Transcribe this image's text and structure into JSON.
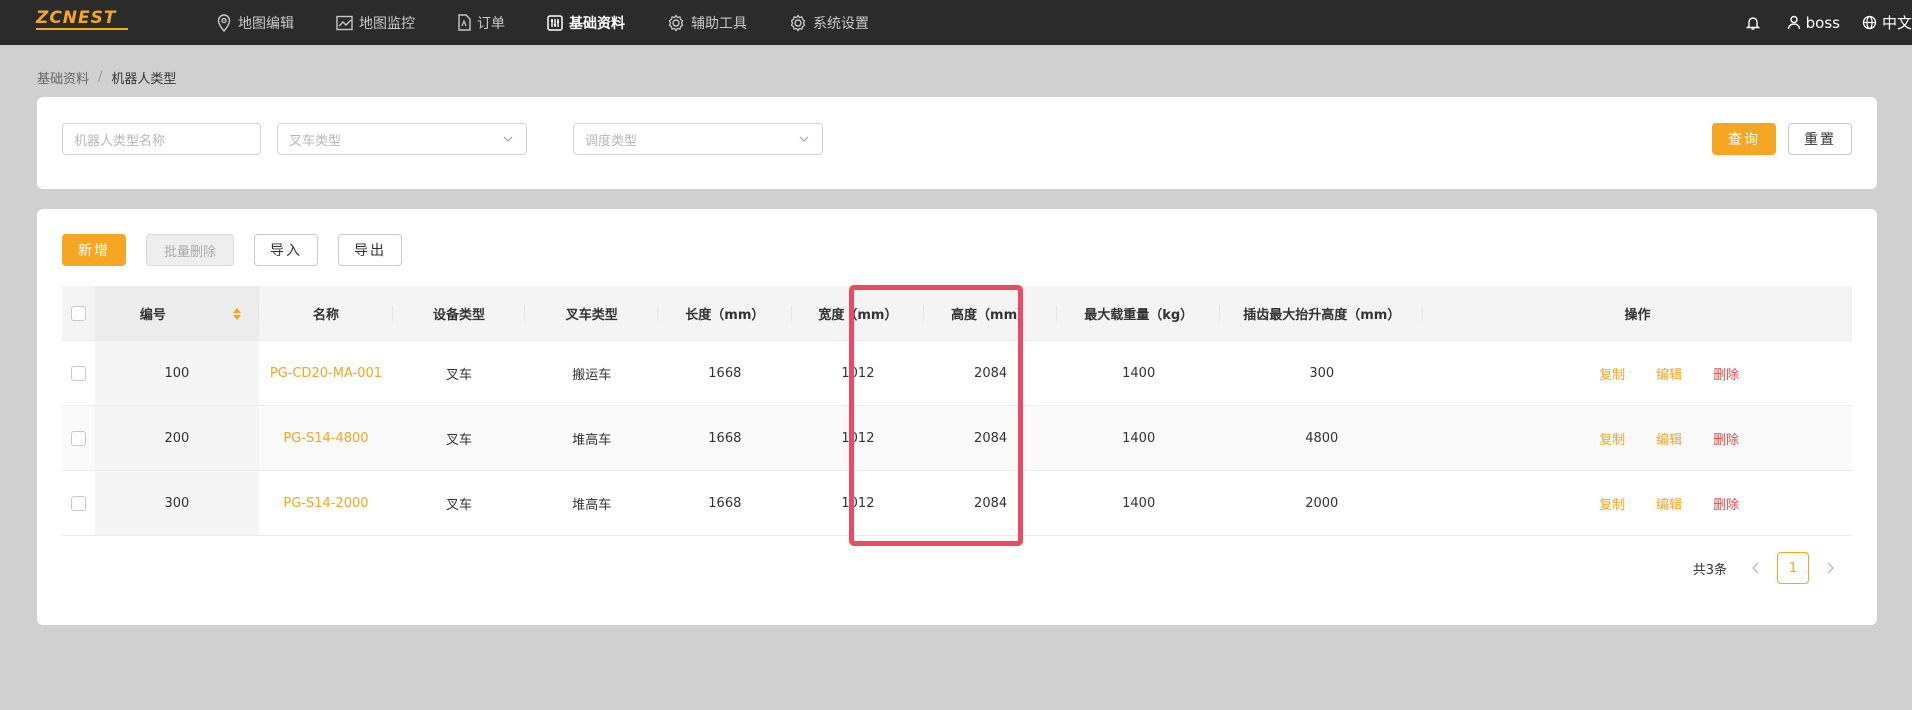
{
  "brand": {
    "logo_text": "ZCNEST",
    "accent": "#f5a623"
  },
  "nav": {
    "items": [
      {
        "label": "地图编辑",
        "icon": "map-pin-icon"
      },
      {
        "label": "地图监控",
        "icon": "chart-line-icon"
      },
      {
        "label": "订单",
        "icon": "document-icon"
      },
      {
        "label": "基础资料",
        "icon": "sliders-icon",
        "active": true
      },
      {
        "label": "辅助工具",
        "icon": "gear-icon"
      },
      {
        "label": "系统设置",
        "icon": "gear-icon"
      }
    ]
  },
  "topright": {
    "user": "boss",
    "language": "中文"
  },
  "breadcrumb": {
    "parent": "基础资料",
    "separator": "/",
    "current": "机器人类型"
  },
  "filters": {
    "robot_type_name_placeholder": "机器人类型名称",
    "fork_type_placeholder": "叉车类型",
    "dispatch_type_placeholder": "调度类型",
    "query_label": "查询",
    "reset_label": "重置"
  },
  "toolbar": {
    "add_label": "新增",
    "batch_delete_label": "批量删除",
    "import_label": "导入",
    "export_label": "导出"
  },
  "table": {
    "columns": [
      "编号",
      "名称",
      "设备类型",
      "叉车类型",
      "长度（mm）",
      "宽度（mm）",
      "高度（mm）",
      "最大载重量（kg）",
      "插齿最大抬升高度（mm）",
      "操作"
    ],
    "rows": [
      {
        "no": "100",
        "name": "PG-CD20-MA-001",
        "device_type": "叉车",
        "fork_type": "搬运车",
        "length": "1668",
        "width": "1012",
        "height": "2084",
        "max_load": "1400",
        "max_lift": "300"
      },
      {
        "no": "200",
        "name": "PG-S14-4800",
        "device_type": "叉车",
        "fork_type": "堆高车",
        "length": "1668",
        "width": "1012",
        "height": "2084",
        "max_load": "1400",
        "max_lift": "4800"
      },
      {
        "no": "300",
        "name": "PG-S14-2000",
        "device_type": "叉车",
        "fork_type": "堆高车",
        "length": "1668",
        "width": "1012",
        "height": "2084",
        "max_load": "1400",
        "max_lift": "2000"
      }
    ],
    "actions": {
      "copy": "复制",
      "edit": "编辑",
      "delete": "删除"
    }
  },
  "pagination": {
    "total_text": "共3条",
    "current_page": "1"
  },
  "highlight": {
    "color": "#ea4a63"
  }
}
